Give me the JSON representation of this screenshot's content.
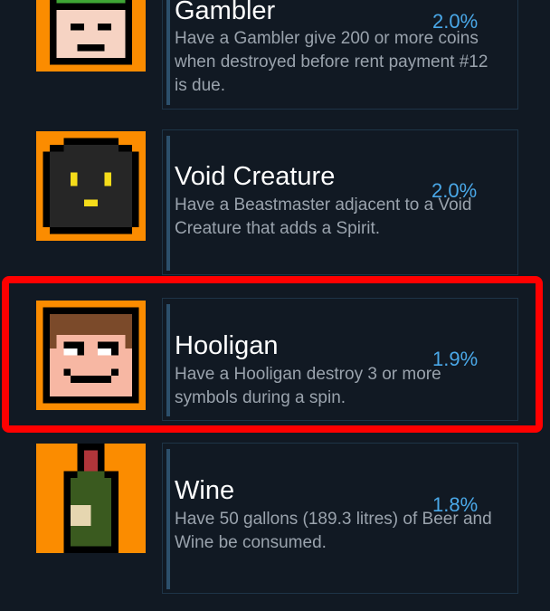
{
  "achievements": [
    {
      "title": "Gambler",
      "description": "Have a Gambler give 200 or more coins when destroyed before rent payment #12 is due.",
      "percent": "2.0%",
      "icon": "gambler-face-icon"
    },
    {
      "title": "Void Creature",
      "description": "Have a Beastmaster adjacent to a Void Creature that adds a Spirit.",
      "percent": "2.0%",
      "icon": "void-creature-icon"
    },
    {
      "title": "Hooligan",
      "description": "Have a Hooligan destroy 3 or more symbols during a spin.",
      "percent": "1.9%",
      "icon": "hooligan-face-icon"
    },
    {
      "title": "Wine",
      "description": "Have 50 gallons (189.3 litres) of Beer and Wine be consumed.",
      "percent": "1.8%",
      "icon": "wine-bottle-icon"
    }
  ],
  "colors": {
    "background": "#111923",
    "icon_background": "#fb8c00",
    "percent": "#4aa8e8",
    "highlight": "#ff0000"
  }
}
